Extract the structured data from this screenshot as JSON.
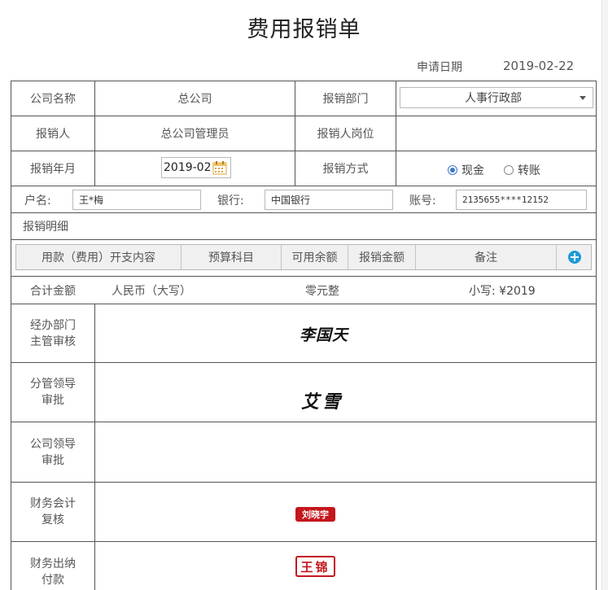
{
  "form": {
    "title": "费用报销单",
    "apply_date_label": "申请日期",
    "apply_date_value": "2019-02-22"
  },
  "row1": {
    "company_label": "公司名称",
    "company_value": "总公司",
    "dept_label": "报销部门",
    "dept_value": "人事行政部"
  },
  "row2": {
    "person_label": "报销人",
    "person_value": "总公司管理员",
    "position_label": "报销人岗位",
    "position_value": ""
  },
  "row3": {
    "month_label": "报销年月",
    "month_value": "2019-02",
    "method_label": "报销方式",
    "methods": [
      {
        "label": "现金",
        "checked": true
      },
      {
        "label": "转账",
        "checked": false
      }
    ]
  },
  "bank": {
    "account_name_label": "户名:",
    "account_name_value": "王*梅",
    "bank_label": "银行:",
    "bank_value": "中国银行",
    "account_no_label": "账号:",
    "account_no_value": "2135655****12152"
  },
  "details": {
    "label": "报销明细",
    "columns": [
      "用款（费用）开支内容",
      "预算科目",
      "可用余额",
      "报销金额",
      "备注"
    ]
  },
  "total": {
    "label": "合计金额",
    "upper_label": "人民币（大写）",
    "upper_value": "零元整",
    "lower_label": "小写: ¥2019"
  },
  "approvals": [
    {
      "label_line1": "经办部门",
      "label_line2": "主管审核",
      "signature": "李国天",
      "kind": "handwritten"
    },
    {
      "label_line1": "分管领导",
      "label_line2": "审批",
      "signature": "艾雪",
      "kind": "handwritten"
    },
    {
      "label_line1": "公司领导",
      "label_line2": "审批",
      "signature": "",
      "kind": "none"
    },
    {
      "label_line1": "财务会计",
      "label_line2": "复核",
      "signature": "刘晓宇",
      "kind": "stamp"
    },
    {
      "label_line1": "财务出纳",
      "label_line2": "付款",
      "signature": "王锦",
      "kind": "stamp"
    }
  ],
  "colors": {
    "border": "#555555",
    "stamp_red": "#c4161c",
    "accent_blue": "#1d9bd8",
    "radio_blue": "#3b77c8"
  },
  "icons": {
    "calendar": "calendar-icon",
    "add": "add-circle-icon",
    "dropdown": "chevron-down-icon"
  }
}
